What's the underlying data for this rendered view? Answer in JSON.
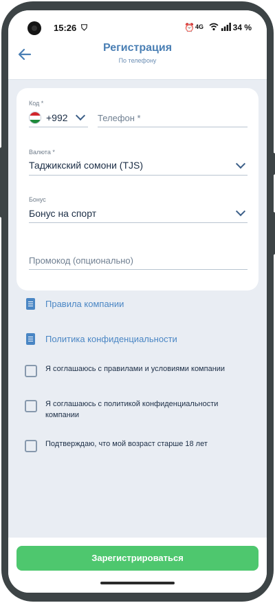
{
  "status_bar": {
    "time": "15:26",
    "network": "4G",
    "battery": "34 %"
  },
  "header": {
    "title": "Регистрация",
    "subtitle": "По телефону"
  },
  "form": {
    "code_label": "Код *",
    "code_value": "+992",
    "phone_placeholder": "Телефон *",
    "currency_label": "Валюта *",
    "currency_value": "Таджикский сомони (TJS)",
    "bonus_label": "Бонус",
    "bonus_value": "Бонус на спорт",
    "promo_placeholder": "Промокод (опционально)"
  },
  "links": {
    "rules": "Правила компании",
    "privacy": "Политика конфиденциальности"
  },
  "checkboxes": {
    "terms": "Я соглашаюсь с правилами и условиями компании",
    "privacy": "Я соглашаюсь с политикой конфиденциальности компании",
    "age": "Подтверждаю, что мой возраст старше 18 лет"
  },
  "submit_label": "Зарегистрироваться",
  "colors": {
    "accent": "#4a86c4",
    "submit": "#4ec76e",
    "background": "#e9edf3"
  }
}
